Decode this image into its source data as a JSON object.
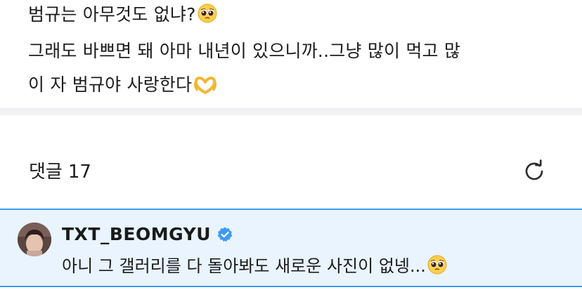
{
  "post": {
    "lines": [
      "범규는 아무것도 없냐?",
      "그래도 바쁘면 돼 아마 내년이 있으니까..그냥 많이 먹고 많",
      "이 자 범규야 사랑한다"
    ],
    "line1_emoji": "pleading-face-emoji",
    "line3_emoji": "heart-hands-emoji"
  },
  "comments": {
    "label": "댓글",
    "count": "17",
    "refresh_icon": "refresh-icon"
  },
  "comment": {
    "author": "TXT_BEOMGYU",
    "verified": true,
    "text": "아니 그 갤러리를 다 돌아봐도 새로운 사진이 없넹...",
    "trailing_emoji": "pleading-face-emoji",
    "highlight_color": "#3d9bf5",
    "background_color": "#e9f4fe"
  }
}
